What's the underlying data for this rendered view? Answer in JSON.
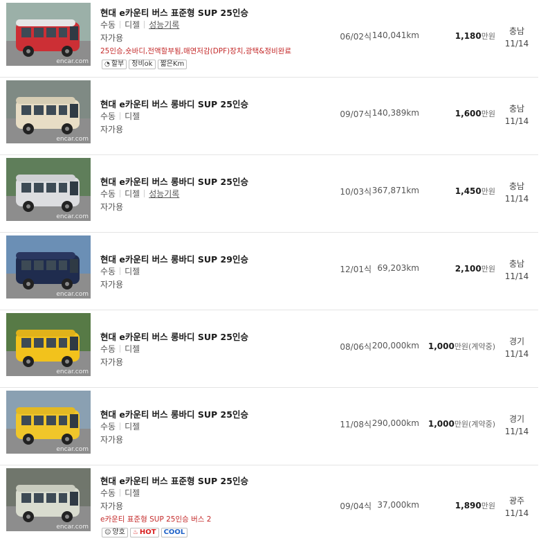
{
  "watermark": "encar.com",
  "listings": [
    {
      "title": "현대 e카운티 버스 표준형 SUP 25인승",
      "transmission": "수동",
      "fuel": "디젤",
      "record_link": "성능기록",
      "usage": "자가용",
      "note": "25인승,숏바디,전액할부됨,매연저감(DPF)장치,광택&정비완료",
      "badges": [
        {
          "icon": "pie-chart-icon",
          "text": "할부"
        },
        {
          "text": "정비ok"
        },
        {
          "text": "짧은Km"
        }
      ],
      "year": "06/02식",
      "mileage": "140,041km",
      "price": "1,180",
      "price_unit": "만원",
      "region": "충남",
      "date": "11/14",
      "photo_colors": {
        "body": "#cc2f35",
        "roof": "#e6e6e6",
        "bg": "#9bb0a8"
      }
    },
    {
      "title": "현대 e카운티 버스 롱바디 SUP 25인승",
      "transmission": "수동",
      "fuel": "디젤",
      "usage": "자가용",
      "year": "09/07식",
      "mileage": "140,389km",
      "price": "1,600",
      "price_unit": "만원",
      "region": "충남",
      "date": "11/14",
      "photo_colors": {
        "body": "#e8ddc5",
        "roof": "#d6cdb4",
        "bg": "#7f8a84"
      }
    },
    {
      "title": "현대 e카운티 버스 롱바디 SUP 25인승",
      "transmission": "수동",
      "fuel": "디젤",
      "record_link": "성능기록",
      "usage": "자가용",
      "year": "10/03식",
      "mileage": "367,871km",
      "price": "1,450",
      "price_unit": "만원",
      "region": "충남",
      "date": "11/14",
      "photo_colors": {
        "body": "#dcdde0",
        "roof": "#cfd0d3",
        "bg": "#5f7e5a"
      }
    },
    {
      "title": "현대 e카운티 버스 롱바디 SUP 29인승",
      "transmission": "수동",
      "fuel": "디젤",
      "usage": "자가용",
      "year": "12/01식",
      "mileage": "69,203km",
      "price": "2,100",
      "price_unit": "만원",
      "region": "충남",
      "date": "11/14",
      "photo_colors": {
        "body": "#1f2c4e",
        "roof": "#2a3760",
        "bg": "#6b8fb5"
      }
    },
    {
      "title": "현대 e카운티 버스 롱바디 SUP 25인승",
      "transmission": "수동",
      "fuel": "디젤",
      "usage": "자가용",
      "year": "08/06식",
      "mileage": "200,000km",
      "price": "1,000",
      "price_unit": "만원(계약중)",
      "region": "경기",
      "date": "11/14",
      "photo_colors": {
        "body": "#f2c21c",
        "roof": "#e0b21a",
        "bg": "#577a46"
      }
    },
    {
      "title": "현대 e카운티 버스 롱바디 SUP 25인승",
      "transmission": "수동",
      "fuel": "디젤",
      "usage": "자가용",
      "year": "11/08식",
      "mileage": "290,000km",
      "price": "1,000",
      "price_unit": "만원(계약중)",
      "region": "경기",
      "date": "11/14",
      "photo_colors": {
        "body": "#f0c62a",
        "roof": "#e3b923",
        "bg": "#8aa0b2"
      }
    },
    {
      "title": "현대 e카운티 버스 표준형 SUP 25인승",
      "transmission": "수동",
      "fuel": "디젤",
      "usage": "자가용",
      "note": "e카운티 표준형 SUP 25인승 버스 2",
      "badges": [
        {
          "icon": "smile-icon",
          "text": "양호"
        },
        {
          "icon": "fire-icon",
          "text": "HOT",
          "style": "hot"
        },
        {
          "text": "COOL",
          "style": "cool"
        }
      ],
      "year": "09/04식",
      "mileage": "37,000km",
      "price": "1,890",
      "price_unit": "만원",
      "region": "광주",
      "date": "11/14",
      "photo_colors": {
        "body": "#d9dccf",
        "roof": "#c9ccbf",
        "bg": "#70766d"
      }
    }
  ]
}
